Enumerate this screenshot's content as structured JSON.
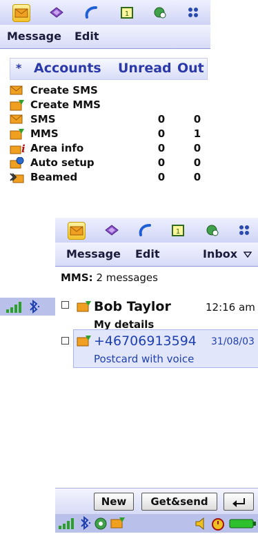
{
  "back_window": {
    "app_bar": {
      "icons": [
        "messaging-icon",
        "contacts-icon",
        "phone-icon",
        "calendar-icon",
        "web-icon",
        "menu-grid-icon"
      ]
    },
    "menu": {
      "message": "Message",
      "edit": "Edit"
    },
    "accounts_header": {
      "star": "*",
      "accounts": "Accounts",
      "unread": "Unread",
      "out": "Out"
    },
    "rows": [
      {
        "label": "Create SMS",
        "icon": "sms-icon",
        "unread": "",
        "out": ""
      },
      {
        "label": "Create MMS",
        "icon": "mms-icon",
        "unread": "",
        "out": ""
      },
      {
        "label": "SMS",
        "icon": "sms-icon",
        "unread": "0",
        "out": "0"
      },
      {
        "label": "MMS",
        "icon": "mms-icon",
        "unread": "0",
        "out": "1"
      },
      {
        "label": "Area info",
        "icon": "area-info-icon",
        "unread": "0",
        "out": "0"
      },
      {
        "label": "Auto setup",
        "icon": "auto-setup-icon",
        "unread": "0",
        "out": "0"
      },
      {
        "label": "Beamed",
        "icon": "beamed-icon",
        "unread": "0",
        "out": "0"
      }
    ],
    "status_icons": [
      "signal-icon",
      "bluetooth-icon"
    ]
  },
  "front_window": {
    "menu": {
      "message": "Message",
      "edit": "Edit",
      "folder": "Inbox"
    },
    "count": {
      "label": "MMS:",
      "text": "2 messages"
    },
    "messages": [
      {
        "sender": "Bob Taylor",
        "time": "12:16 am",
        "subject": "My details"
      },
      {
        "sender": "+46706913594",
        "time": "31/08/03",
        "subject": "Postcard with voice"
      }
    ],
    "buttons": {
      "new": "New",
      "get_send": "Get&send",
      "back_icon": "back-arrow-icon"
    },
    "status_icons": [
      "signal-icon",
      "bluetooth-icon",
      "web-icon",
      "mms-icon",
      "speaker-icon",
      "alarm-icon",
      "battery-icon"
    ]
  },
  "colors": {
    "header_text": "#2b3aa8",
    "bar_gradient_top": "#eef0ff",
    "bar_gradient_bottom": "#cfd4f5",
    "selection": "#e1e6fb",
    "status_bar": "#b9c1ea"
  }
}
